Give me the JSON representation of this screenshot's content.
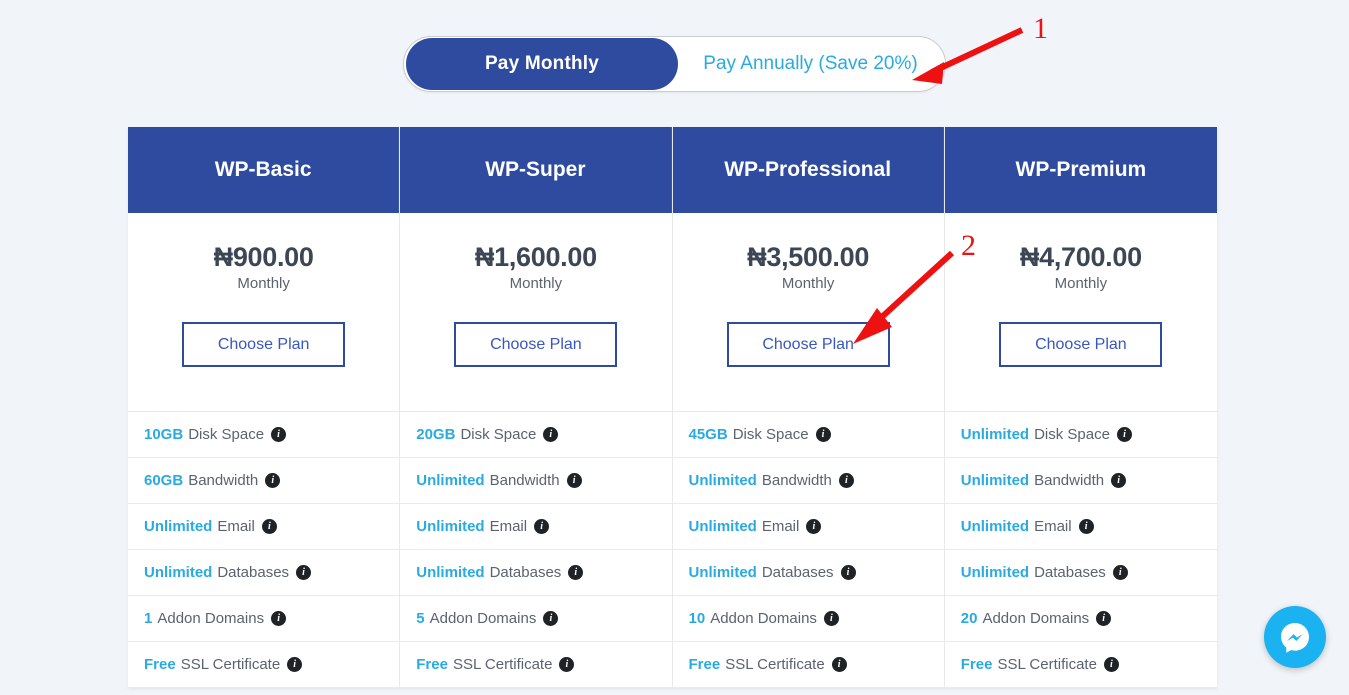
{
  "billing_toggle": {
    "monthly_label": "Pay Monthly",
    "annually_label": "Pay Annually (Save 20%)",
    "active": "monthly"
  },
  "colors": {
    "header_blue": "#2e4ba0",
    "value_cyan": "#29abe2",
    "page_bg": "#f1f4f8",
    "annotation_red": "#ee1111",
    "messenger_blue": "#1ab2f0"
  },
  "plans": [
    {
      "name": "WP-Basic",
      "price": "₦900.00",
      "period": "Monthly",
      "cta": "Choose Plan",
      "features": [
        {
          "value": "10GB",
          "label": "Disk Space"
        },
        {
          "value": "60GB",
          "label": "Bandwidth"
        },
        {
          "value": "Unlimited",
          "label": "Email"
        },
        {
          "value": "Unlimited",
          "label": "Databases"
        },
        {
          "value": "1",
          "label": "Addon Domains"
        },
        {
          "value": "Free",
          "label": "SSL Certificate"
        }
      ]
    },
    {
      "name": "WP-Super",
      "price": "₦1,600.00",
      "period": "Monthly",
      "cta": "Choose Plan",
      "features": [
        {
          "value": "20GB",
          "label": "Disk Space"
        },
        {
          "value": "Unlimited",
          "label": "Bandwidth"
        },
        {
          "value": "Unlimited",
          "label": "Email"
        },
        {
          "value": "Unlimited",
          "label": "Databases"
        },
        {
          "value": "5",
          "label": "Addon Domains"
        },
        {
          "value": "Free",
          "label": "SSL Certificate"
        }
      ]
    },
    {
      "name": "WP-Professional",
      "price": "₦3,500.00",
      "period": "Monthly",
      "cta": "Choose Plan",
      "features": [
        {
          "value": "45GB",
          "label": "Disk Space"
        },
        {
          "value": "Unlimited",
          "label": "Bandwidth"
        },
        {
          "value": "Unlimited",
          "label": "Email"
        },
        {
          "value": "Unlimited",
          "label": "Databases"
        },
        {
          "value": "10",
          "label": "Addon Domains"
        },
        {
          "value": "Free",
          "label": "SSL Certificate"
        }
      ]
    },
    {
      "name": "WP-Premium",
      "price": "₦4,700.00",
      "period": "Monthly",
      "cta": "Choose Plan",
      "features": [
        {
          "value": "Unlimited",
          "label": "Disk Space"
        },
        {
          "value": "Unlimited",
          "label": "Bandwidth"
        },
        {
          "value": "Unlimited",
          "label": "Email"
        },
        {
          "value": "Unlimited",
          "label": "Databases"
        },
        {
          "value": "20",
          "label": "Addon Domains"
        },
        {
          "value": "Free",
          "label": "SSL Certificate"
        }
      ]
    }
  ],
  "info_icon_glyph": "i",
  "annotations": [
    {
      "number": "1"
    },
    {
      "number": "2"
    }
  ],
  "messenger": {
    "icon": "messenger-icon"
  }
}
